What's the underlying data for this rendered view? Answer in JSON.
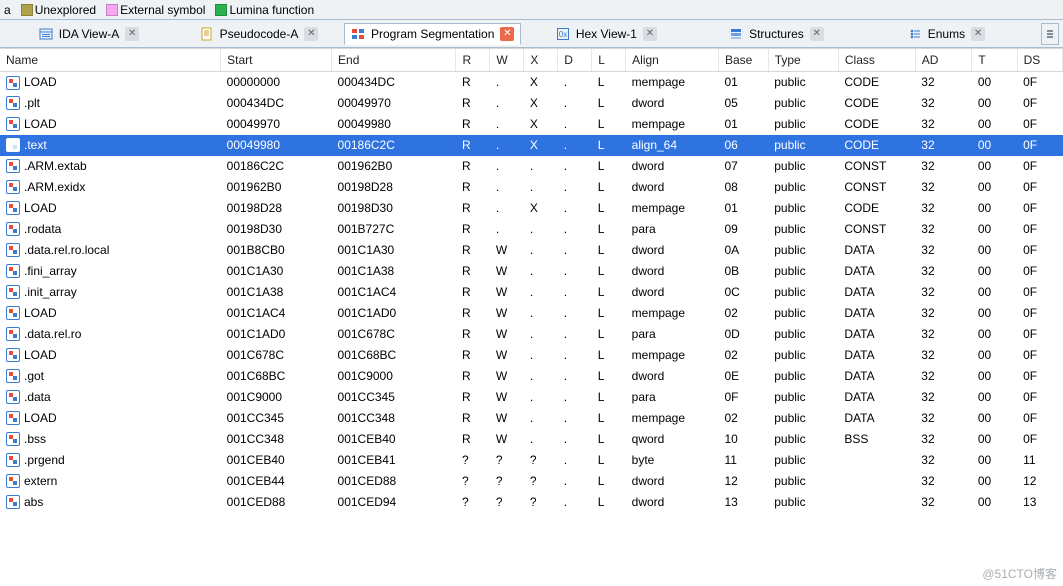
{
  "legend": [
    {
      "label": "a",
      "color": ""
    },
    {
      "label": "Unexplored",
      "color": "#b0a24a"
    },
    {
      "label": "External symbol",
      "color": "#f7a6f1"
    },
    {
      "label": "Lumina function",
      "color": "#2bb24c"
    }
  ],
  "tabs": [
    {
      "id": "ida-view",
      "icon": "window-list",
      "label": "IDA View-A",
      "active": false
    },
    {
      "id": "pseudo",
      "icon": "doc-yellow",
      "label": "Pseudocode-A",
      "active": false
    },
    {
      "id": "progseg",
      "icon": "segments",
      "label": "Program Segmentation",
      "active": true
    },
    {
      "id": "hexview",
      "icon": "hex-blue",
      "label": "Hex View-1",
      "active": false
    },
    {
      "id": "structs",
      "icon": "struct-blue",
      "label": "Structures",
      "active": false
    },
    {
      "id": "enums",
      "icon": "enum-blue",
      "label": "Enums",
      "active": false
    }
  ],
  "columns": [
    "Name",
    "Start",
    "End",
    "R",
    "W",
    "X",
    "D",
    "L",
    "Align",
    "Base",
    "Type",
    "Class",
    "AD",
    "T",
    "DS"
  ],
  "selected_index": 3,
  "rows": [
    {
      "name": "LOAD",
      "start": "00000000",
      "end": "000434DC",
      "r": "R",
      "w": ".",
      "x": "X",
      "d": ".",
      "l": "L",
      "align": "mempage",
      "base": "01",
      "type": "public",
      "class": "CODE",
      "ad": "32",
      "t": "00",
      "ds": "0F"
    },
    {
      "name": ".plt",
      "start": "000434DC",
      "end": "00049970",
      "r": "R",
      "w": ".",
      "x": "X",
      "d": ".",
      "l": "L",
      "align": "dword",
      "base": "05",
      "type": "public",
      "class": "CODE",
      "ad": "32",
      "t": "00",
      "ds": "0F"
    },
    {
      "name": "LOAD",
      "start": "00049970",
      "end": "00049980",
      "r": "R",
      "w": ".",
      "x": "X",
      "d": ".",
      "l": "L",
      "align": "mempage",
      "base": "01",
      "type": "public",
      "class": "CODE",
      "ad": "32",
      "t": "00",
      "ds": "0F"
    },
    {
      "name": ".text",
      "start": "00049980",
      "end": "00186C2C",
      "r": "R",
      "w": ".",
      "x": "X",
      "d": ".",
      "l": "L",
      "align": "align_64",
      "base": "06",
      "type": "public",
      "class": "CODE",
      "ad": "32",
      "t": "00",
      "ds": "0F"
    },
    {
      "name": ".ARM.extab",
      "start": "00186C2C",
      "end": "001962B0",
      "r": "R",
      "w": ".",
      "x": ".",
      "d": ".",
      "l": "L",
      "align": "dword",
      "base": "07",
      "type": "public",
      "class": "CONST",
      "ad": "32",
      "t": "00",
      "ds": "0F"
    },
    {
      "name": ".ARM.exidx",
      "start": "001962B0",
      "end": "00198D28",
      "r": "R",
      "w": ".",
      "x": ".",
      "d": ".",
      "l": "L",
      "align": "dword",
      "base": "08",
      "type": "public",
      "class": "CONST",
      "ad": "32",
      "t": "00",
      "ds": "0F"
    },
    {
      "name": "LOAD",
      "start": "00198D28",
      "end": "00198D30",
      "r": "R",
      "w": ".",
      "x": "X",
      "d": ".",
      "l": "L",
      "align": "mempage",
      "base": "01",
      "type": "public",
      "class": "CODE",
      "ad": "32",
      "t": "00",
      "ds": "0F"
    },
    {
      "name": ".rodata",
      "start": "00198D30",
      "end": "001B727C",
      "r": "R",
      "w": ".",
      "x": ".",
      "d": ".",
      "l": "L",
      "align": "para",
      "base": "09",
      "type": "public",
      "class": "CONST",
      "ad": "32",
      "t": "00",
      "ds": "0F"
    },
    {
      "name": ".data.rel.ro.local",
      "start": "001B8CB0",
      "end": "001C1A30",
      "r": "R",
      "w": "W",
      "x": ".",
      "d": ".",
      "l": "L",
      "align": "dword",
      "base": "0A",
      "type": "public",
      "class": "DATA",
      "ad": "32",
      "t": "00",
      "ds": "0F"
    },
    {
      "name": ".fini_array",
      "start": "001C1A30",
      "end": "001C1A38",
      "r": "R",
      "w": "W",
      "x": ".",
      "d": ".",
      "l": "L",
      "align": "dword",
      "base": "0B",
      "type": "public",
      "class": "DATA",
      "ad": "32",
      "t": "00",
      "ds": "0F"
    },
    {
      "name": ".init_array",
      "start": "001C1A38",
      "end": "001C1AC4",
      "r": "R",
      "w": "W",
      "x": ".",
      "d": ".",
      "l": "L",
      "align": "dword",
      "base": "0C",
      "type": "public",
      "class": "DATA",
      "ad": "32",
      "t": "00",
      "ds": "0F"
    },
    {
      "name": "LOAD",
      "start": "001C1AC4",
      "end": "001C1AD0",
      "r": "R",
      "w": "W",
      "x": ".",
      "d": ".",
      "l": "L",
      "align": "mempage",
      "base": "02",
      "type": "public",
      "class": "DATA",
      "ad": "32",
      "t": "00",
      "ds": "0F"
    },
    {
      "name": ".data.rel.ro",
      "start": "001C1AD0",
      "end": "001C678C",
      "r": "R",
      "w": "W",
      "x": ".",
      "d": ".",
      "l": "L",
      "align": "para",
      "base": "0D",
      "type": "public",
      "class": "DATA",
      "ad": "32",
      "t": "00",
      "ds": "0F"
    },
    {
      "name": "LOAD",
      "start": "001C678C",
      "end": "001C68BC",
      "r": "R",
      "w": "W",
      "x": ".",
      "d": ".",
      "l": "L",
      "align": "mempage",
      "base": "02",
      "type": "public",
      "class": "DATA",
      "ad": "32",
      "t": "00",
      "ds": "0F"
    },
    {
      "name": ".got",
      "start": "001C68BC",
      "end": "001C9000",
      "r": "R",
      "w": "W",
      "x": ".",
      "d": ".",
      "l": "L",
      "align": "dword",
      "base": "0E",
      "type": "public",
      "class": "DATA",
      "ad": "32",
      "t": "00",
      "ds": "0F"
    },
    {
      "name": ".data",
      "start": "001C9000",
      "end": "001CC345",
      "r": "R",
      "w": "W",
      "x": ".",
      "d": ".",
      "l": "L",
      "align": "para",
      "base": "0F",
      "type": "public",
      "class": "DATA",
      "ad": "32",
      "t": "00",
      "ds": "0F"
    },
    {
      "name": "LOAD",
      "start": "001CC345",
      "end": "001CC348",
      "r": "R",
      "w": "W",
      "x": ".",
      "d": ".",
      "l": "L",
      "align": "mempage",
      "base": "02",
      "type": "public",
      "class": "DATA",
      "ad": "32",
      "t": "00",
      "ds": "0F"
    },
    {
      "name": ".bss",
      "start": "001CC348",
      "end": "001CEB40",
      "r": "R",
      "w": "W",
      "x": ".",
      "d": ".",
      "l": "L",
      "align": "qword",
      "base": "10",
      "type": "public",
      "class": "BSS",
      "ad": "32",
      "t": "00",
      "ds": "0F"
    },
    {
      "name": ".prgend",
      "start": "001CEB40",
      "end": "001CEB41",
      "r": "?",
      "w": "?",
      "x": "?",
      "d": ".",
      "l": "L",
      "align": "byte",
      "base": "11",
      "type": "public",
      "class": "",
      "ad": "32",
      "t": "00",
      "ds": "11"
    },
    {
      "name": "extern",
      "start": "001CEB44",
      "end": "001CED88",
      "r": "?",
      "w": "?",
      "x": "?",
      "d": ".",
      "l": "L",
      "align": "dword",
      "base": "12",
      "type": "public",
      "class": "",
      "ad": "32",
      "t": "00",
      "ds": "12"
    },
    {
      "name": "abs",
      "start": "001CED88",
      "end": "001CED94",
      "r": "?",
      "w": "?",
      "x": "?",
      "d": ".",
      "l": "L",
      "align": "dword",
      "base": "13",
      "type": "public",
      "class": "",
      "ad": "32",
      "t": "00",
      "ds": "13"
    }
  ],
  "watermark": "@51CTO博客"
}
